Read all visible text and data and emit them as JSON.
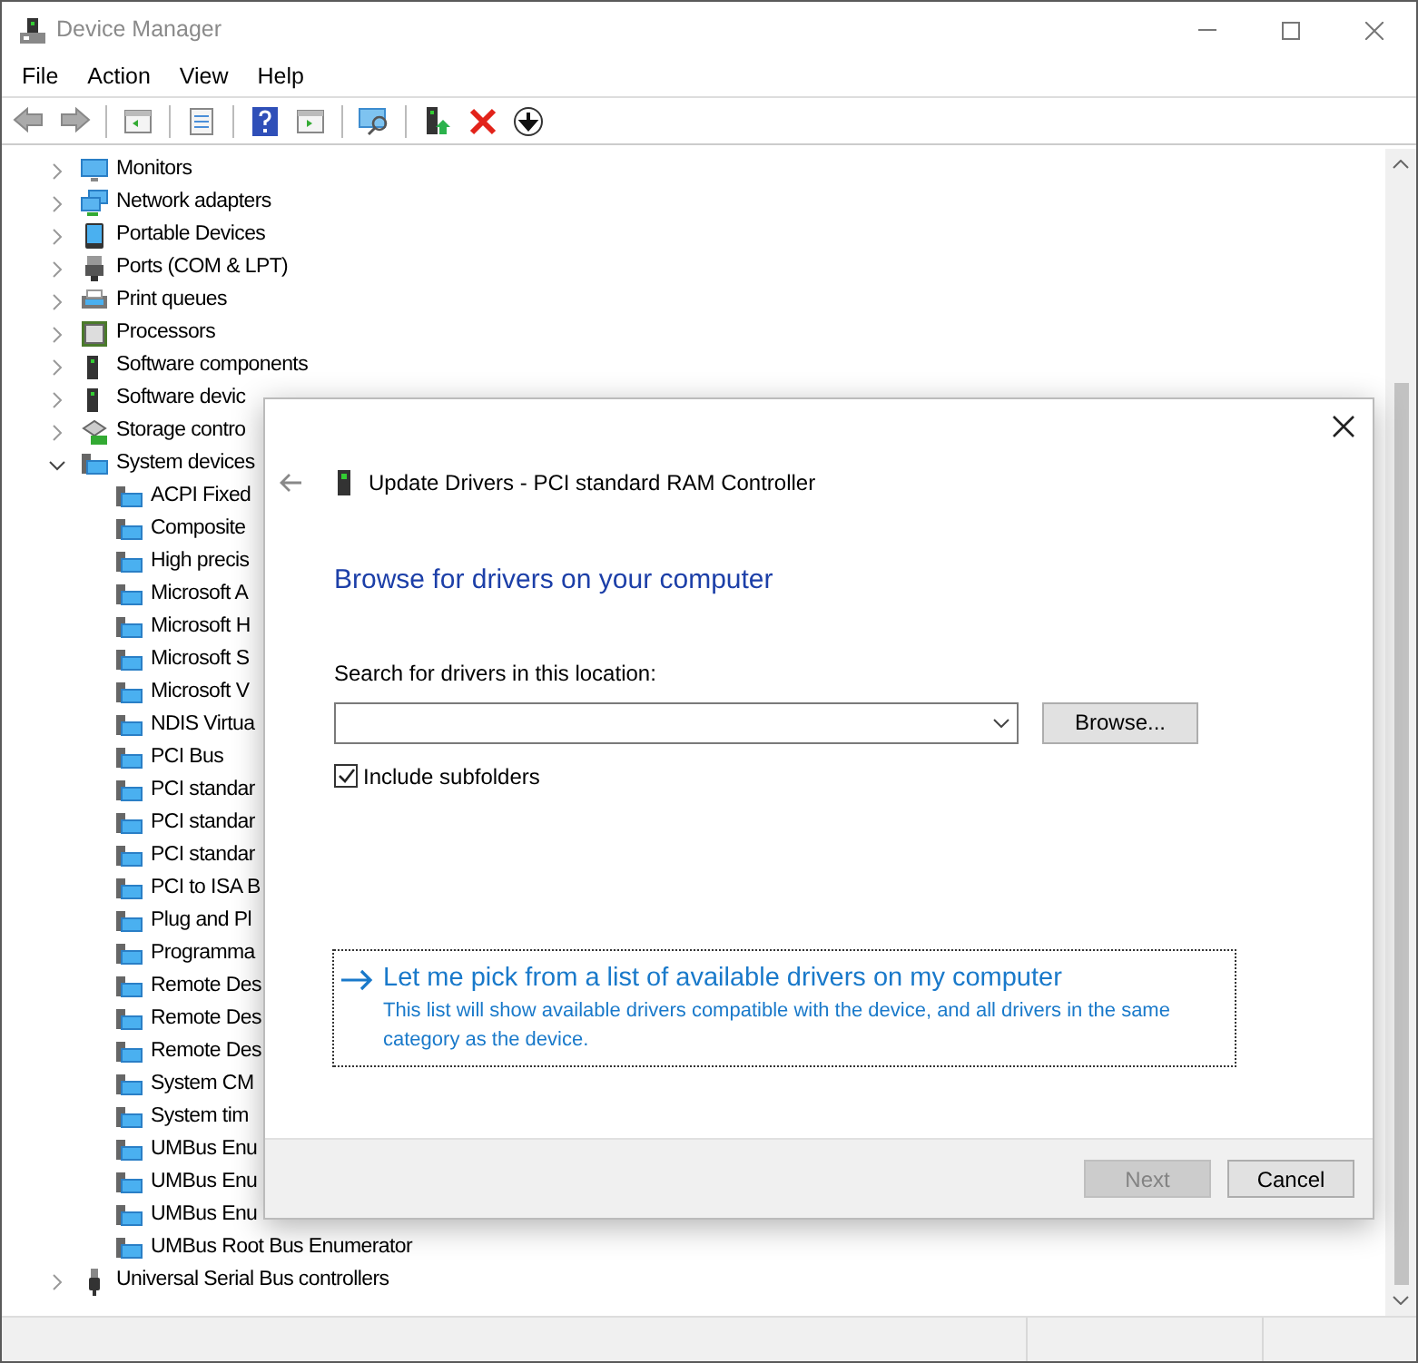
{
  "window": {
    "title": "Device Manager"
  },
  "menu": [
    "File",
    "Action",
    "View",
    "Help"
  ],
  "tree": [
    {
      "label": "Monitors",
      "expanded": false,
      "kind": "monitor"
    },
    {
      "label": "Network adapters",
      "expanded": false,
      "kind": "network"
    },
    {
      "label": "Portable Devices",
      "expanded": false,
      "kind": "portable"
    },
    {
      "label": "Ports (COM & LPT)",
      "expanded": false,
      "kind": "port"
    },
    {
      "label": "Print queues",
      "expanded": false,
      "kind": "printer"
    },
    {
      "label": "Processors",
      "expanded": false,
      "kind": "chip"
    },
    {
      "label": "Software components",
      "expanded": false,
      "kind": "tower"
    },
    {
      "label": "Software devic",
      "expanded": false,
      "kind": "tower"
    },
    {
      "label": "Storage contro",
      "expanded": false,
      "kind": "storage"
    },
    {
      "label": "System devices",
      "expanded": true,
      "kind": "system",
      "children": [
        {
          "label": "ACPI Fixed"
        },
        {
          "label": "Composite"
        },
        {
          "label": "High precis"
        },
        {
          "label": "Microsoft A"
        },
        {
          "label": "Microsoft H"
        },
        {
          "label": "Microsoft S"
        },
        {
          "label": "Microsoft V"
        },
        {
          "label": "NDIS Virtua"
        },
        {
          "label": "PCI Bus"
        },
        {
          "label": "PCI standar"
        },
        {
          "label": "PCI standar"
        },
        {
          "label": "PCI standar"
        },
        {
          "label": "PCI to ISA B"
        },
        {
          "label": "Plug and Pl"
        },
        {
          "label": "Programma"
        },
        {
          "label": "Remote Des"
        },
        {
          "label": "Remote Des"
        },
        {
          "label": "Remote Des"
        },
        {
          "label": "System CM"
        },
        {
          "label": "System tim"
        },
        {
          "label": "UMBus Enu"
        },
        {
          "label": "UMBus Enu"
        },
        {
          "label": "UMBus Enu"
        },
        {
          "label": "UMBus Root Bus Enumerator"
        }
      ]
    },
    {
      "label": "Universal Serial Bus controllers",
      "expanded": false,
      "kind": "usb"
    }
  ],
  "dialog": {
    "title": "Update Drivers - PCI standard RAM Controller",
    "heading": "Browse for drivers on your computer",
    "location_label": "Search for drivers in this location:",
    "browse_button": "Browse...",
    "include_subfolders": {
      "label": "Include subfolders",
      "checked": true
    },
    "pick_option": {
      "title": "Let me pick from a list of available drivers on my computer",
      "description": "This list will show available drivers compatible with the device, and all drivers in the same category as the device."
    },
    "buttons": [
      {
        "label": "Next",
        "disabled": true
      },
      {
        "label": "Cancel",
        "disabled": false
      }
    ]
  }
}
